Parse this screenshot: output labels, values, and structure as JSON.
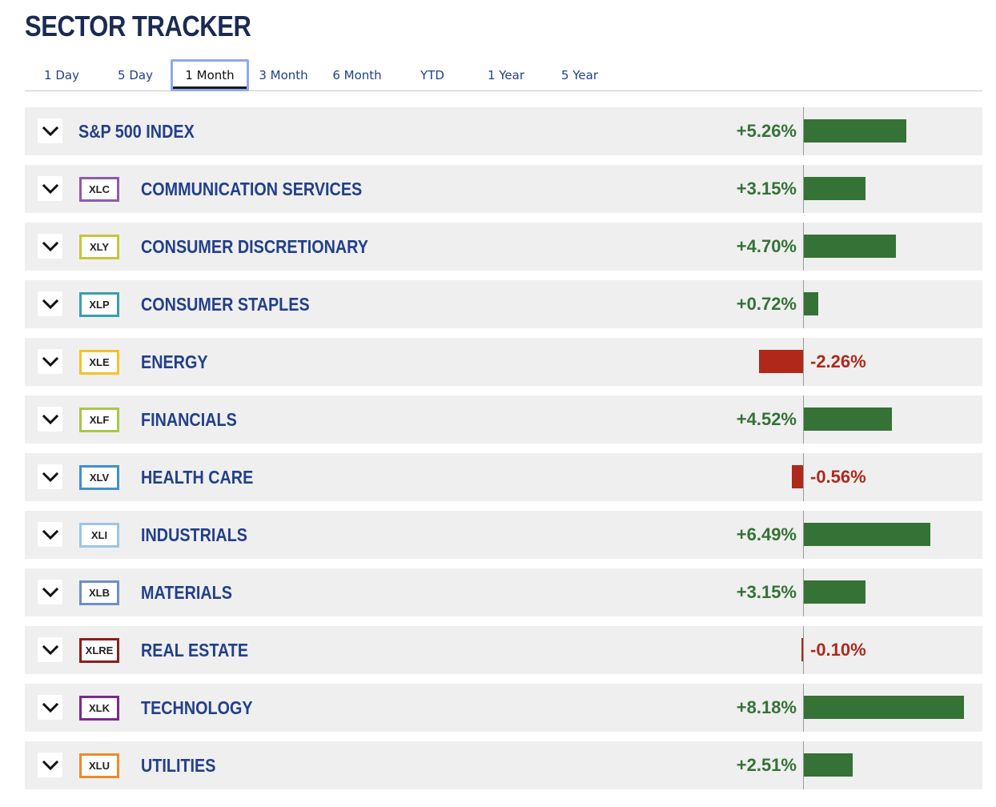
{
  "title": "SECTOR TRACKER",
  "tabs": [
    {
      "label": "1 Day"
    },
    {
      "label": "5 Day"
    },
    {
      "label": "1 Month",
      "active": true
    },
    {
      "label": "3 Month"
    },
    {
      "label": "6 Month"
    },
    {
      "label": "YTD"
    },
    {
      "label": "1 Year"
    },
    {
      "label": "5 Year"
    }
  ],
  "colors": {
    "positive": "#347235",
    "negative": "#b0281a",
    "label": "#22408a",
    "title": "#1b2a52",
    "row_bg": "#efefef"
  },
  "rows": [
    {
      "name": "S&P 500 INDEX",
      "ticker": "",
      "value": 5.26,
      "display": "+5.26%",
      "badge_color": ""
    },
    {
      "name": "COMMUNICATION SERVICES",
      "ticker": "XLC",
      "value": 3.15,
      "display": "+3.15%",
      "badge_color": "#8e5bab"
    },
    {
      "name": "CONSUMER DISCRETIONARY",
      "ticker": "XLY",
      "value": 4.7,
      "display": "+4.70%",
      "badge_color": "#c6c63a"
    },
    {
      "name": "CONSUMER STAPLES",
      "ticker": "XLP",
      "value": 0.72,
      "display": "+0.72%",
      "badge_color": "#3a9fae"
    },
    {
      "name": "ENERGY",
      "ticker": "XLE",
      "value": -2.26,
      "display": "-2.26%",
      "badge_color": "#f3c12b"
    },
    {
      "name": "FINANCIALS",
      "ticker": "XLF",
      "value": 4.52,
      "display": "+4.52%",
      "badge_color": "#a6c84a"
    },
    {
      "name": "HEALTH CARE",
      "ticker": "XLV",
      "value": -0.56,
      "display": "-0.56%",
      "badge_color": "#3f8fd4"
    },
    {
      "name": "INDUSTRIALS",
      "ticker": "XLI",
      "value": 6.49,
      "display": "+6.49%",
      "badge_color": "#9cc6e6"
    },
    {
      "name": "MATERIALS",
      "ticker": "XLB",
      "value": 3.15,
      "display": "+3.15%",
      "badge_color": "#6f8ec6"
    },
    {
      "name": "REAL ESTATE",
      "ticker": "XLRE",
      "value": -0.1,
      "display": "-0.10%",
      "badge_color": "#8a1e1e"
    },
    {
      "name": "TECHNOLOGY",
      "ticker": "XLK",
      "value": 8.18,
      "display": "+8.18%",
      "badge_color": "#7a2a8a"
    },
    {
      "name": "UTILITIES",
      "ticker": "XLU",
      "value": 2.51,
      "display": "+2.51%",
      "badge_color": "#ee8a2a"
    }
  ]
}
